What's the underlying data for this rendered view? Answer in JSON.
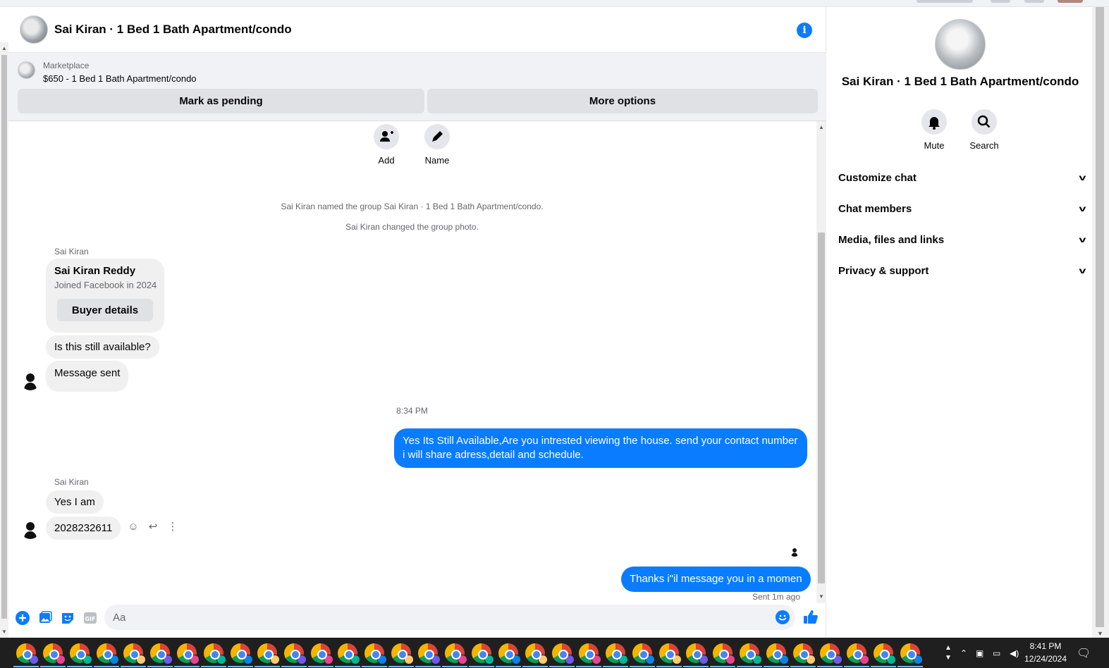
{
  "chat": {
    "title": "Sai Kiran · 1 Bed 1 Bath Apartment/condo",
    "marketplace": {
      "label": "Marketplace",
      "listing": "$650 - 1 Bed 1 Bath Apartment/condo",
      "pending_btn": "Mark as pending",
      "options_btn": "More options"
    },
    "actions": {
      "add": "Add",
      "name": "Name"
    },
    "system": {
      "named": "Sai Kiran named the group Sai Kiran · 1 Bed 1 Bath Apartment/condo.",
      "photo": "Sai Kiran changed the group photo."
    },
    "sender_name": "Sai Kiran",
    "profile_card": {
      "name": "Sai Kiran Reddy",
      "joined": "Joined Facebook in 2024",
      "button": "Buyer details"
    },
    "messages": {
      "m1": "Is this still available?",
      "m2": "Message sent",
      "timestamp": "8:34 PM",
      "reply1": "Yes Its Still Available,Are you intrested viewing the house. send your contact number i will share adress,detail and schedule.",
      "m3": "Yes I am",
      "m4": "2028232611",
      "reply2": "Thanks i\"il message you in a momen",
      "sent_status": "Sent 1m ago"
    },
    "composer": {
      "placeholder": "Aa"
    }
  },
  "details": {
    "title": "Sai Kiran · 1 Bed 1 Bath Apartment/condo",
    "mute": "Mute",
    "search": "Search",
    "sections": [
      "Customize chat",
      "Chat members",
      "Media, files and links",
      "Privacy & support"
    ]
  },
  "taskbar": {
    "time": "8:41 PM",
    "date": "12/24/2024"
  },
  "colors": {
    "accent": "#0a7cff",
    "bubble_in": "#f0f0f0",
    "banner": "#f0f2f5"
  },
  "icons": [
    "info-icon",
    "add-person-icon",
    "pencil-icon",
    "bell-icon",
    "search-icon",
    "chevron-down-icon",
    "plus-icon",
    "photo-icon",
    "sticker-icon",
    "gif-icon",
    "emoji-icon",
    "like-icon",
    "reply-icon",
    "more-icon",
    "browser-icon"
  ]
}
